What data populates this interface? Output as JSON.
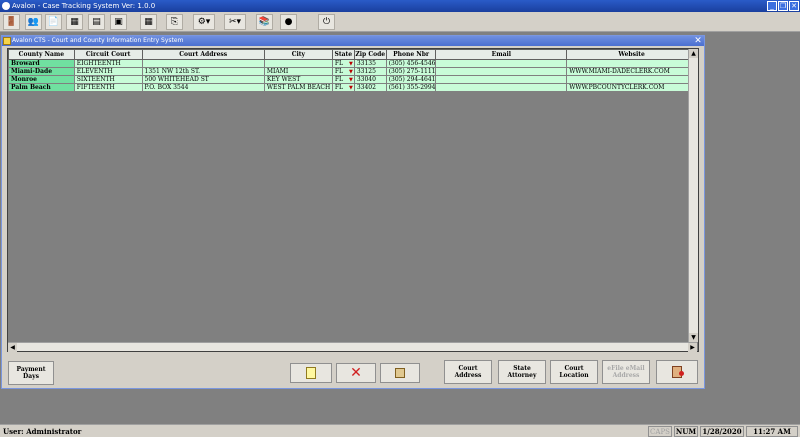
{
  "app": {
    "title": "Avalon - Case Tracking System   Ver: 1.0.0"
  },
  "window": {
    "title": "Avalon CTS - Court and County Information Entry System"
  },
  "grid": {
    "columns": [
      "County Name",
      "Circuit Court",
      "Court Address",
      "City",
      "State",
      "Zip Code",
      "Phone Nbr",
      "Email",
      "Website"
    ],
    "rows": [
      {
        "county": "Broward",
        "circuit": "EIGHTEENTH",
        "address": "",
        "city": "",
        "state": "FL",
        "zip": "33135",
        "phone": "(305) 456-4546",
        "email": "",
        "website": ""
      },
      {
        "county": "Miami-Dade",
        "circuit": "ELEVENTH",
        "address": "1351 NW 12th ST.",
        "city": "MIAMI",
        "state": "FL",
        "zip": "33125",
        "phone": "(305) 275-1111",
        "email": "",
        "website": "WWW.MIAMI-DADECLERK.COM"
      },
      {
        "county": "Monroe",
        "circuit": "SIXTEENTH",
        "address": "500 WHITEHEAD ST",
        "city": "KEY WEST",
        "state": "FL",
        "zip": "33040",
        "phone": "(305) 294-4641",
        "email": "",
        "website": ""
      },
      {
        "county": "Palm Beach",
        "circuit": "FIFTEENTH",
        "address": "P.O. BOX 3544",
        "city": "WEST PALM BEACH",
        "state": "FL",
        "zip": "33402",
        "phone": "(561) 355-2994",
        "email": "",
        "website": "WWW.PBCOUNTYCLERK.COM"
      }
    ]
  },
  "buttons": {
    "payment_days": "Payment Days",
    "court_address": "Court Address",
    "state_attorney": "State Attorney",
    "court_location": "Court Location",
    "efile_email": "eFile eMail Address"
  },
  "status": {
    "user": "User: Administrator",
    "caps": "CAPS",
    "num": "NUM",
    "date": "1/28/2020",
    "time": "11:27 AM"
  }
}
